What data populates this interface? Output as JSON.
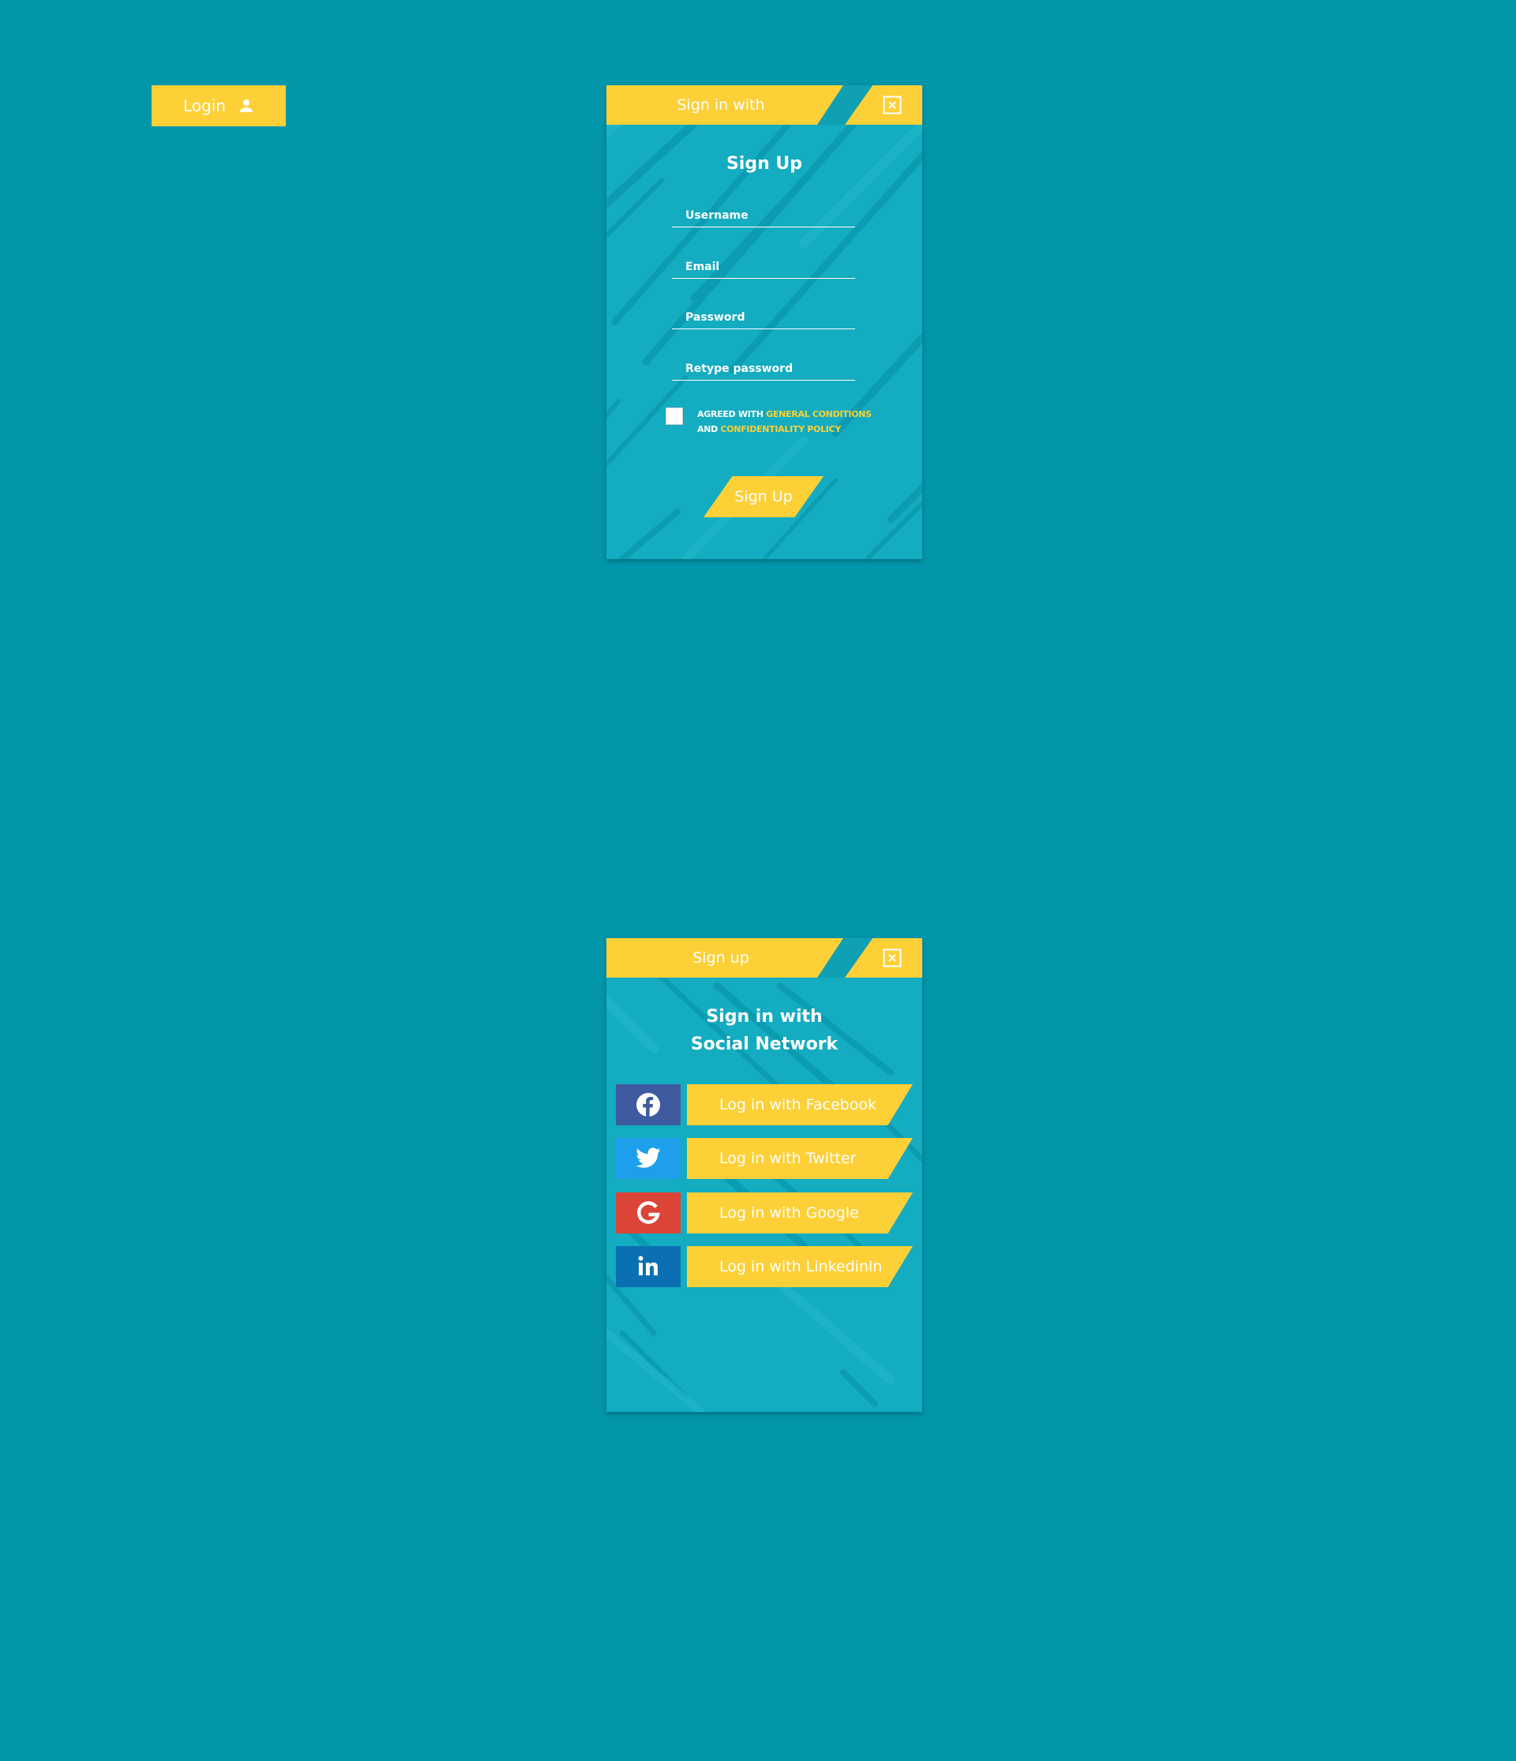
{
  "login_button": {
    "label": "Login",
    "icon": "user-icon"
  },
  "signup_panel": {
    "header_tab": "Sign in with",
    "close_icon": "close-icon",
    "title": "Sign Up",
    "fields": [
      {
        "placeholder": "Username",
        "value": ""
      },
      {
        "placeholder": "Email",
        "value": ""
      },
      {
        "placeholder": "Password",
        "value": ""
      },
      {
        "placeholder": "Retype password",
        "value": ""
      }
    ],
    "agreement": {
      "checked": false,
      "prefix": "AGREED WITH",
      "link1": "GENERAL CONDITIONS",
      "middle": "AND",
      "link2": "CONFIDENTIALITY POLICY"
    },
    "submit_label": "Sign Up"
  },
  "social_panel": {
    "header_tab": "Sign up",
    "close_icon": "close-icon",
    "title_line1": "Sign in with",
    "title_line2": "Social Network",
    "providers": [
      {
        "name": "facebook",
        "label": "Log in with Facebook",
        "icon": "facebook-icon",
        "color": "#3D5B9E"
      },
      {
        "name": "twitter",
        "label": "Log in with Twitter",
        "icon": "twitter-icon",
        "color": "#1D9FEC"
      },
      {
        "name": "google",
        "label": "Log in with Google",
        "icon": "google-icon",
        "color": "#DB4437"
      },
      {
        "name": "linkedin",
        "label": "Log in with Linkedinln",
        "icon": "linkedin-icon",
        "color": "#0A70B3"
      }
    ]
  },
  "colors": {
    "background": "#0296AB",
    "panel": "#13ACC0",
    "accent": "#FDD037",
    "text": "#FFFFFF"
  }
}
